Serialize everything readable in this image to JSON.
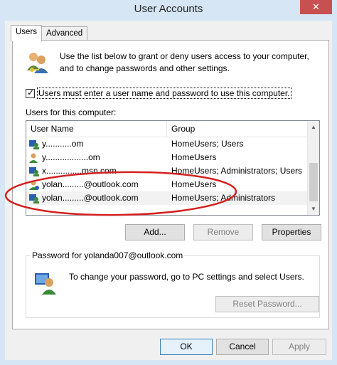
{
  "window": {
    "title": "User Accounts",
    "close_glyph": "✕"
  },
  "tabs": [
    {
      "label": "Users"
    },
    {
      "label": "Advanced"
    }
  ],
  "intro": {
    "text": "Use the list below to grant or deny users access to your computer, and to change passwords and other settings."
  },
  "require_login": {
    "checked": true,
    "label": "Users must enter a user name and password to use this computer."
  },
  "users_label": "Users for this computer:",
  "list": {
    "columns": [
      "User Name",
      "Group"
    ],
    "rows": [
      {
        "name": "y...........om",
        "group": "HomeUsers; Users"
      },
      {
        "name": "y..................om",
        "group": "HomeUsers"
      },
      {
        "name": "x...............msn.com",
        "group": "HomeUsers; Administrators; Users"
      },
      {
        "name": "yolan.........@outlook.com",
        "group": "HomeUsers"
      },
      {
        "name": "yolan.........@outlook.com",
        "group": "HomeUsers; Administrators"
      }
    ]
  },
  "buttons": {
    "add": "Add...",
    "remove": "Remove",
    "properties": "Properties"
  },
  "password_group": {
    "title": "Password for yolanda007@outlook.com",
    "text": "To change your password, go to PC settings and select Users.",
    "reset": "Reset Password..."
  },
  "footer": {
    "ok": "OK",
    "cancel": "Cancel",
    "apply": "Apply"
  },
  "colors": {
    "annotation": "#d42020",
    "titlebar": "#d6e6f5",
    "close": "#c75050"
  }
}
